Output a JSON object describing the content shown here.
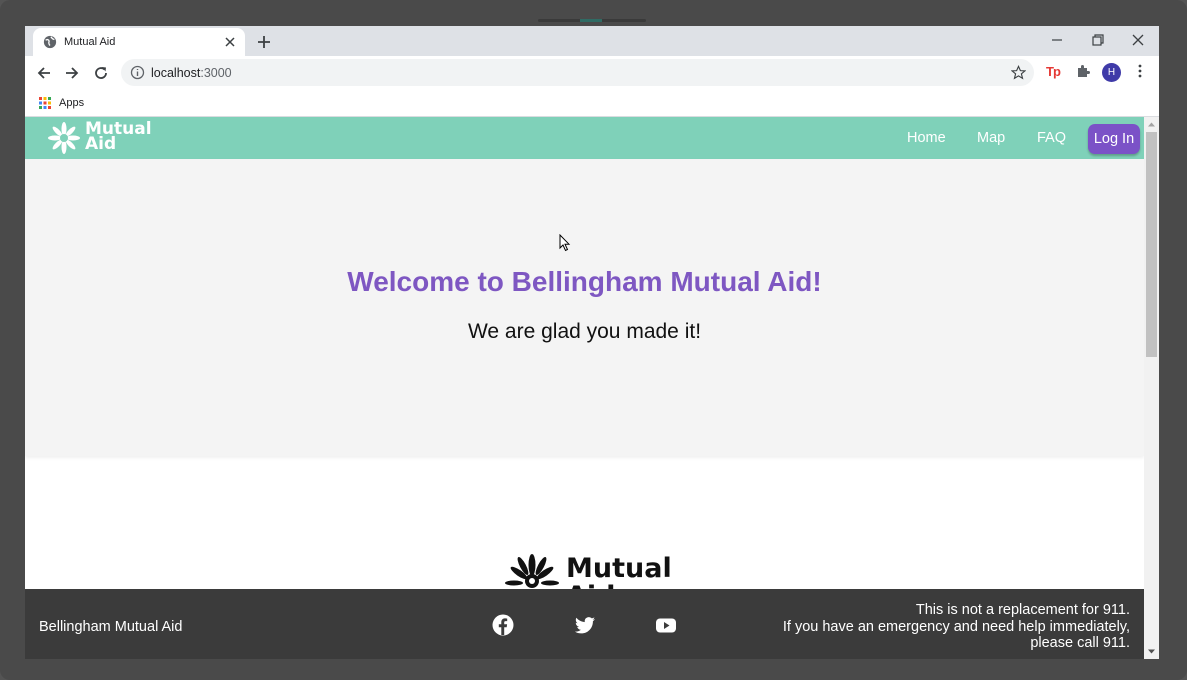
{
  "browser": {
    "tab_title": "Mutual Aid",
    "url_host": "localhost",
    "url_port": ":3000",
    "bookmarks_apps_label": "Apps",
    "profile_initial": "H",
    "extension_tp_label": "Tp"
  },
  "site": {
    "brand_line1": "Mutual",
    "brand_line2": "Aid",
    "nav": {
      "home": "Home",
      "map": "Map",
      "faq": "FAQ",
      "login": "Log In"
    },
    "hero": {
      "title": "Welcome to Bellingham Mutual Aid!",
      "subtitle": "We are glad you made it!"
    },
    "lower_brand_line1": "Mutual",
    "lower_brand_line2": "Aid",
    "footer": {
      "org_name": "Bellingham Mutual Aid",
      "note_line1": "This is not a replacement for 911.",
      "note_line2": "If you have an emergency and need help immediately,",
      "note_line3": "please call 911."
    }
  },
  "colors": {
    "nav_bg": "#7fd1b9",
    "accent_purple": "#7e57c2",
    "login_bg": "#7b52c7",
    "footer_bg": "#3b3b3b",
    "hero_bg": "#f4f4f4"
  },
  "icons": {
    "tab_favicon": "globe-icon",
    "tab_close": "close-icon",
    "new_tab": "plus-icon",
    "back": "back-arrow-icon",
    "forward": "forward-arrow-icon",
    "reload": "reload-icon",
    "site_info": "info-icon",
    "bookmark": "star-icon",
    "extensions": "puzzle-icon",
    "menu": "kebab-menu-icon",
    "site_logo": "mutual-aid-flower-logo",
    "facebook": "facebook-icon",
    "twitter": "twitter-icon",
    "youtube": "youtube-icon"
  }
}
